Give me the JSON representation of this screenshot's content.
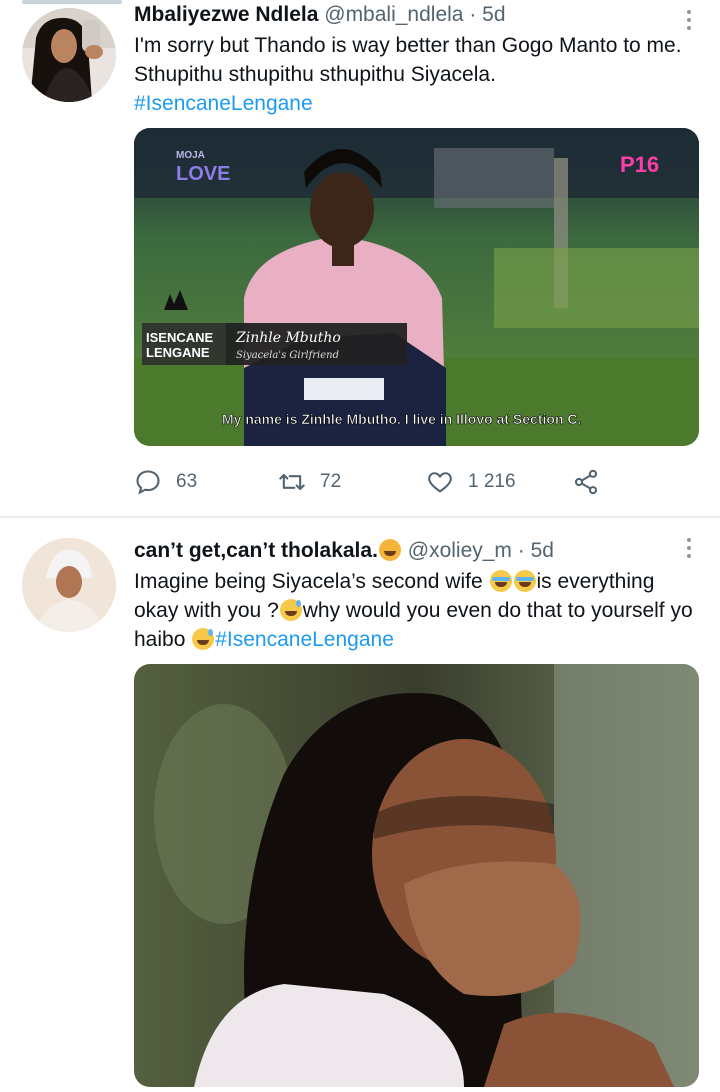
{
  "tweets": [
    {
      "display_name": "Mbaliyezwe Ndlela",
      "handle": "@mbali_ndlela",
      "separator": "·",
      "age": "5d",
      "text": "I'm sorry but Thando is way better than Gogo Manto to me. Sthupithu sthupithu sthupithu Siyacela.",
      "hashtag": "#IsencaneLengane",
      "media": {
        "channel_logo_top": "MOJA",
        "channel_logo_bottom": "LOVE",
        "rating": "P16",
        "show_title_line1": "ISENCANE",
        "show_title_line2": "LENGANE",
        "lower_third_name": "Zinhle Mbutho",
        "lower_third_role": "Siyacela's Girlfriend",
        "subtitle": "My name is Zinhle Mbutho. I live in Illovo at Section C."
      },
      "counts": {
        "replies": "63",
        "retweets": "72",
        "likes": "1 216"
      }
    },
    {
      "display_name": "can’t get,can’t tholakala.",
      "handle": "@xoliey_m",
      "separator": "·",
      "age": "5d",
      "text_part1": "Imagine being Siyacela’s second wife ",
      "text_part2": "is everything okay with you ?",
      "text_part3": "why would you even do that to yourself yo haibo ",
      "hashtag": "#IsencaneLengane"
    }
  ],
  "icons": [
    "reply-icon",
    "retweet-icon",
    "like-icon",
    "share-icon",
    "more-icon"
  ],
  "colors": {
    "link": "#1d9bf0",
    "secondary_text": "#536471",
    "divider": "#e6ecf0"
  }
}
